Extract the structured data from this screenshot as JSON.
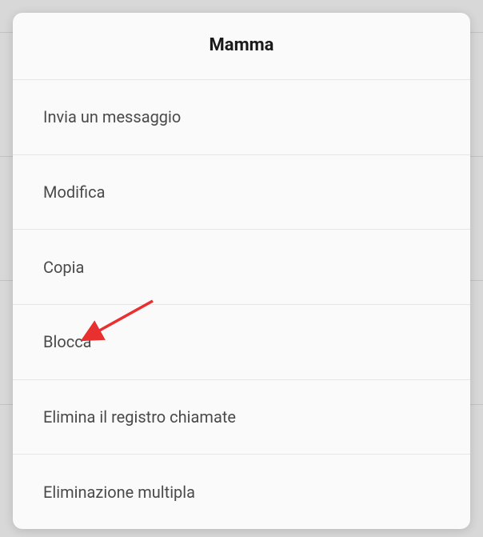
{
  "dialog": {
    "title": "Mamma",
    "items": [
      {
        "label": "Invia un messaggio"
      },
      {
        "label": "Modifica"
      },
      {
        "label": "Copia"
      },
      {
        "label": "Blocca"
      },
      {
        "label": "Elimina il registro chiamate"
      },
      {
        "label": "Eliminazione multipla"
      }
    ]
  }
}
